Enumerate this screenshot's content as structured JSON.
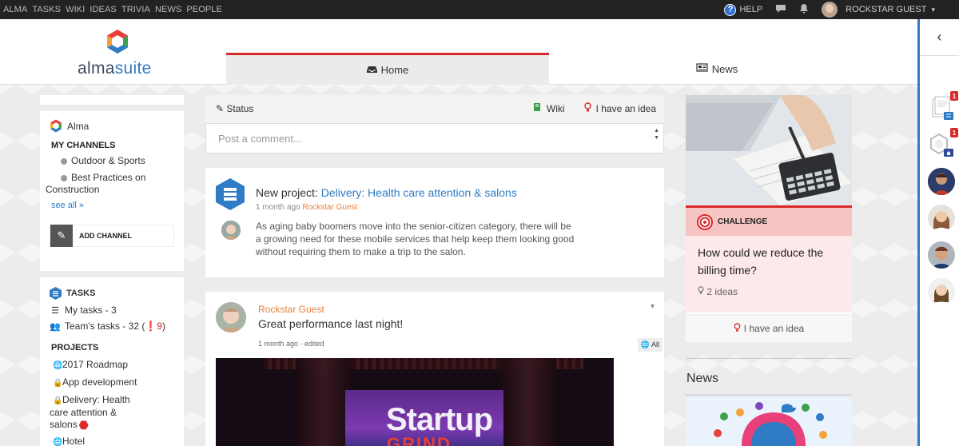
{
  "topnav": {
    "items": [
      "ALMA",
      "TASKS",
      "WIKI",
      "IDEAS",
      "TRIVIA",
      "NEWS",
      "PEOPLE"
    ],
    "help_label": "HELP",
    "help_mark": "?",
    "user_name": "ROCKSTAR GUEST",
    "user_caret": "▾",
    "chat_icon": "chat-icon",
    "bell_icon": "bell-icon"
  },
  "header": {
    "logo_text_a": "alma",
    "logo_text_b": "suite",
    "tabs": [
      {
        "label": "Home",
        "icon": "inbox-icon",
        "glyph": "🖴"
      },
      {
        "label": "News",
        "icon": "newspaper-icon",
        "glyph": "📰"
      }
    ]
  },
  "rail": {
    "collapse_glyph": "‹",
    "badges": [
      "1",
      "1"
    ]
  },
  "sidebar": {
    "alma_label": "Alma",
    "channels_title": "MY CHANNELS",
    "channels": [
      "Outdoor & Sports",
      "Best Practices on",
      "Construction"
    ],
    "see_all": "see all »",
    "add_channel": "ADD CHANNEL",
    "add_glyph": "✎",
    "tasks_title": "TASKS",
    "my_tasks": "My tasks - 3",
    "team_tasks_a": "Team's tasks - 32 (",
    "team_tasks_warn": "❗9",
    "team_tasks_b": ")",
    "list_glyph": "☰",
    "team_glyph": "👥",
    "projects_title": "PROJECTS",
    "projects": [
      {
        "label": "2017 Roadmap",
        "glyph": "🌐"
      },
      {
        "label": "App development",
        "glyph": "🔒"
      },
      {
        "label": "Delivery: Health",
        "glyph": "🔒"
      },
      {
        "label": "care attention &",
        "glyph": ""
      },
      {
        "label": "salons",
        "glyph": ""
      },
      {
        "label": "Hotel",
        "glyph": "🌐"
      }
    ]
  },
  "status": {
    "status_label": "Status",
    "status_glyph": "✎",
    "wiki_label": "Wiki",
    "wiki_glyph": "📗",
    "idea_label": "I have an idea",
    "idea_glyph": "💡",
    "comment_placeholder": "Post a comment...",
    "spin_up": "▲",
    "spin_down": "▼"
  },
  "posts": [
    {
      "prefix": "New project: ",
      "link": "Delivery: Health care attention & salons",
      "meta_time": "1 month ago ",
      "meta_author": "Rockstar Guest",
      "body": "As aging baby boomers move into the senior-citizen category, there will be a growing need for these mobile services that help keep them looking good without requiring them to make a trip to the salon."
    },
    {
      "author": "Rockstar Guest",
      "text": "Great performance last night!",
      "meta": "1 month ago - edited",
      "all_label": "All",
      "all_glyph": "🌐",
      "chevron": "▾",
      "image_text_1": "Startup",
      "image_text_2": "GRIND"
    }
  ],
  "challenge": {
    "tag": "CHALLENGE",
    "question": "How could we reduce the billing time?",
    "ideas": "2 ideas",
    "ideas_glyph": "💡",
    "cta": "I have an idea",
    "cta_glyph": "💡"
  },
  "news": {
    "title": "News"
  },
  "colors": {
    "accent": "#2f7bc4",
    "danger": "#d92a2a",
    "author": "#e8803a"
  }
}
